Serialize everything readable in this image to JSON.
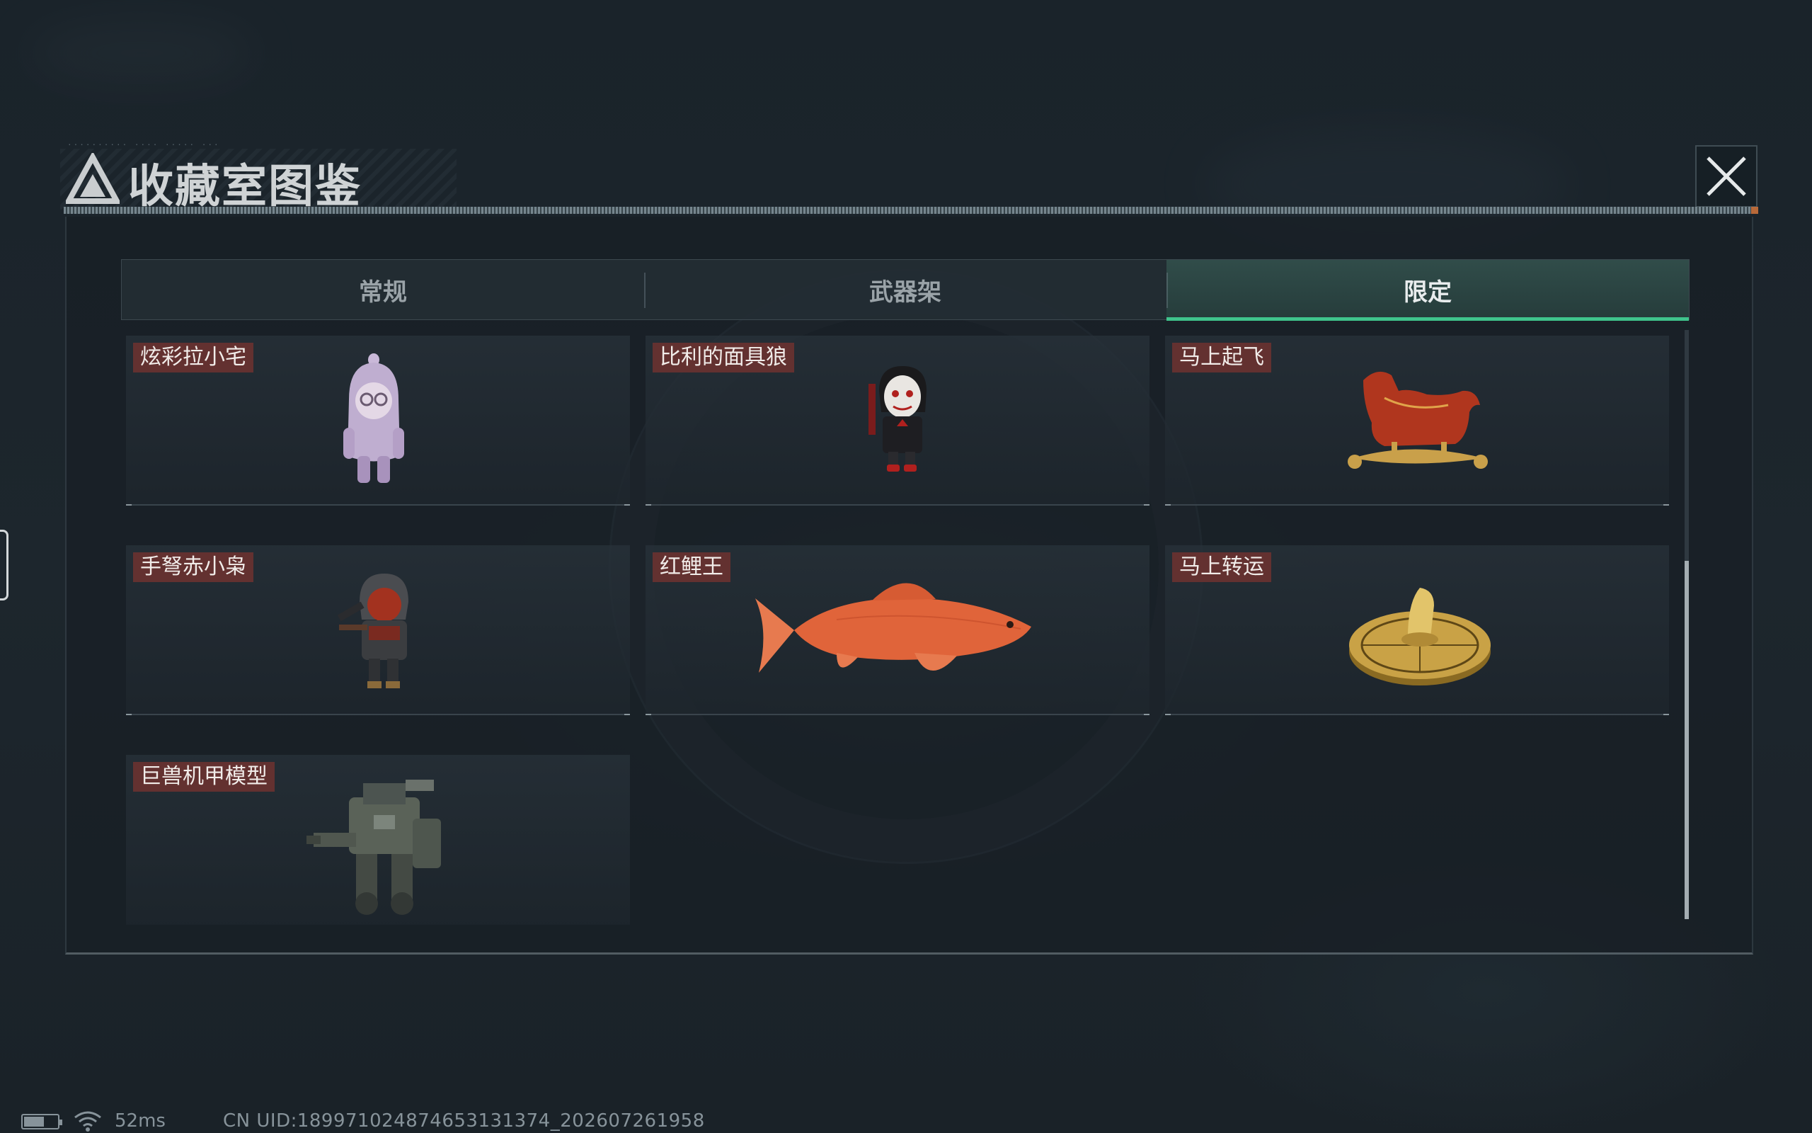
{
  "header": {
    "title": "收藏室图鉴",
    "logo_icon": "triangle-logo-icon",
    "close_icon": "close-icon"
  },
  "tabs": [
    {
      "label": "常规",
      "active": false
    },
    {
      "label": "武器架",
      "active": false
    },
    {
      "label": "限定",
      "active": true
    }
  ],
  "items": [
    {
      "label": "炫彩拉小宅",
      "icon": "hooded-figure-toy-icon"
    },
    {
      "label": "比利的面具狼",
      "icon": "puppet-mask-toy-icon"
    },
    {
      "label": "马上起飞",
      "icon": "red-horse-statue-icon"
    },
    {
      "label": "手弩赤小枭",
      "icon": "hooded-crossbow-figure-icon"
    },
    {
      "label": "红鲤王",
      "icon": "red-carp-fish-icon"
    },
    {
      "label": "马上转运",
      "icon": "golden-horse-coin-icon"
    },
    {
      "label": "巨兽机甲模型",
      "icon": "mech-model-icon"
    }
  ],
  "status": {
    "ping": "52ms",
    "uid": "CN UID:1899710248746531313​74_202607261958"
  },
  "colors": {
    "accent": "#3fc48c",
    "label_bg": "#69322f",
    "panel_bg": "#182026"
  }
}
